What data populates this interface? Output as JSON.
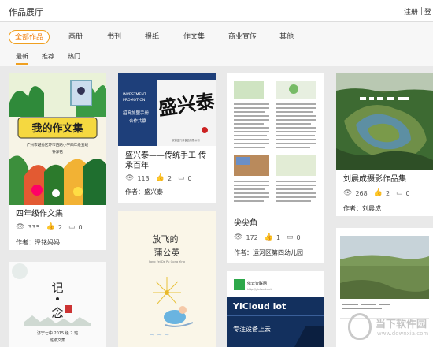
{
  "header": {
    "title": "作品展厅",
    "register": "注册",
    "login_trunc": "登"
  },
  "categories": [
    {
      "label": "全部作品",
      "active": true
    },
    {
      "label": "画册"
    },
    {
      "label": "书刊"
    },
    {
      "label": "报纸"
    },
    {
      "label": "作文集"
    },
    {
      "label": "商业宣传"
    },
    {
      "label": "其他"
    }
  ],
  "sorts": [
    {
      "label": "最新",
      "active": true
    },
    {
      "label": "推荐"
    },
    {
      "label": "热门"
    }
  ],
  "cards": [
    {
      "title": "四年级作文集",
      "views": "335",
      "likes": "2",
      "comments": "0",
      "author": "作者：泽铭妈妈",
      "cover": {
        "heading": "我的作文集",
        "school": "广州市越秀区环市西路小学四年级五班",
        "teacher": "钟泽铭"
      }
    },
    {
      "title": "盛兴泰——传统手工 传承百年",
      "views": "113",
      "likes": "2",
      "comments": "0",
      "author": "作者：盛兴泰",
      "cover": {
        "line1": "INVESTMENT",
        "line2": "PROMOTION",
        "sub1": "招商加盟手册",
        "sub2": "合作共赢",
        "brand": "盛兴泰",
        "company": "安徽盛兴泰食品有限公司"
      }
    },
    {
      "title": "尖尖角",
      "views": "172",
      "likes": "1",
      "comments": "0",
      "author": "作者：运河区第四幼儿园"
    },
    {
      "title": "刘晨成摄影作品集",
      "views": "268",
      "likes": "2",
      "comments": "0",
      "author": "作者：刘晨成"
    },
    {
      "cover": {
        "char1": "记",
        "char2": "念",
        "line1": "济宁七中 2015 级 2 班",
        "line2": "班级文集"
      }
    },
    {
      "cover": {
        "title": "放飞的",
        "title2": "蒲公英",
        "sub": "Fang Fei De Pu Gong Ying"
      }
    },
    {
      "cover": {
        "brand": "依云智联网",
        "brand_en": "YiCloud iot",
        "url": "http://yicloud.net",
        "tag": "专注设备上云"
      }
    },
    {
      "cover": {}
    }
  ],
  "watermark": {
    "name": "当下软件园",
    "url": "www.downxia.com"
  }
}
